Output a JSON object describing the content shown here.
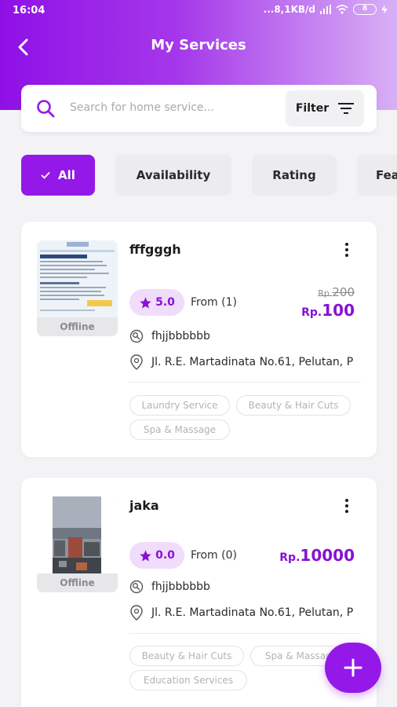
{
  "status_bar": {
    "time": "16:04",
    "network": "...8,1KB/d",
    "battery": "8"
  },
  "header": {
    "title": "My Services"
  },
  "search": {
    "placeholder": "Search for home service...",
    "value": "",
    "filter_label": "Filter"
  },
  "chips": [
    {
      "label": "All",
      "active": true
    },
    {
      "label": "Availability",
      "active": false
    },
    {
      "label": "Rating",
      "active": false
    },
    {
      "label": "Fea",
      "active": false
    }
  ],
  "services": [
    {
      "title": "fffgggh",
      "status": "Offline",
      "rating": "5.0",
      "from_text": "From (1)",
      "price_old_currency": "Rp.",
      "price_old": "200",
      "price_currency": "Rp.",
      "price": "100",
      "provider": "fhjjbbbbbb",
      "address": "Jl. R.E. Martadinata No.61, Pelutan, P",
      "tags": [
        "Laundry Service",
        "Beauty & Hair Cuts",
        "Spa & Massage"
      ]
    },
    {
      "title": "jaka",
      "status": "Offline",
      "rating": "0.0",
      "from_text": "From (0)",
      "price_currency": "Rp.",
      "price": "10000",
      "provider": "fhjjbbbbbb",
      "address": "Jl. R.E. Martadinata No.61, Pelutan, P",
      "tags": [
        "Beauty & Hair Cuts",
        "Spa & Massage",
        "Education Services"
      ]
    }
  ],
  "colors": {
    "accent": "#9419e8",
    "accent_dark": "#8612d4",
    "rating_bg": "#f0dcfb"
  },
  "icons": {
    "back": "arrow-left-icon",
    "search": "search-icon",
    "filter": "filter-icon",
    "star": "star-icon",
    "more": "more-vertical-icon",
    "provider": "provider-icon",
    "location": "location-pin-icon",
    "add": "plus-icon"
  }
}
